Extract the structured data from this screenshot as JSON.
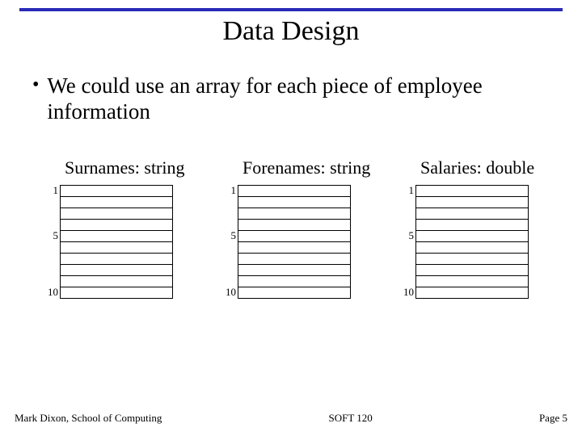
{
  "title": "Data Design",
  "bullet": "We could use an array for each piece of employee information",
  "arrays": [
    {
      "label": "Surnames: string",
      "indices": [
        "1",
        "",
        "",
        "",
        "5",
        "",
        "",
        "",
        "",
        "10"
      ]
    },
    {
      "label": "Forenames: string",
      "indices": [
        "1",
        "",
        "",
        "",
        "5",
        "",
        "",
        "",
        "",
        "10"
      ]
    },
    {
      "label": "Salaries: double",
      "indices": [
        "1",
        "",
        "",
        "",
        "5",
        "",
        "",
        "",
        "",
        "10"
      ]
    }
  ],
  "footer": {
    "left": "Mark Dixon, School of Computing",
    "center": "SOFT 120",
    "right": "Page 5"
  }
}
